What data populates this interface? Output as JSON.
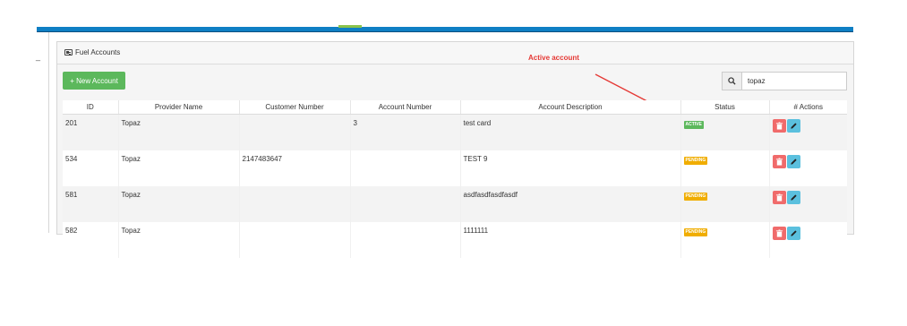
{
  "panel": {
    "title": "Fuel Accounts"
  },
  "annotation": {
    "text": "Active account",
    "color": "#e53935"
  },
  "toolbar": {
    "new_label": "+ New Account"
  },
  "search": {
    "value": "topaz"
  },
  "table": {
    "headers": [
      "ID",
      "Provider Name",
      "Customer Number",
      "Account Number",
      "Account Description",
      "Status",
      "# Actions"
    ],
    "rows": [
      {
        "id": "201",
        "provider": "Topaz",
        "customer": "",
        "account": "3",
        "description": "test card",
        "status": "ACTIVE"
      },
      {
        "id": "534",
        "provider": "Topaz",
        "customer": "2147483647",
        "account": "",
        "description": "TEST 9",
        "status": "PENDING"
      },
      {
        "id": "581",
        "provider": "Topaz",
        "customer": "",
        "account": "",
        "description": "asdfasdfasdfasdf",
        "status": "PENDING"
      },
      {
        "id": "582",
        "provider": "Topaz",
        "customer": "",
        "account": "",
        "description": "1111111",
        "status": "PENDING"
      }
    ]
  },
  "colors": {
    "primary": "#0f7fc4",
    "success": "#5cb85c",
    "active": "#5cb85c",
    "pending": "#f0ad00",
    "danger": "#f06b6b",
    "info": "#5bc0de"
  },
  "icons": {
    "search": "search-icon",
    "delete": "trash-icon",
    "edit": "pencil-icon",
    "panel": "id-card-icon"
  }
}
